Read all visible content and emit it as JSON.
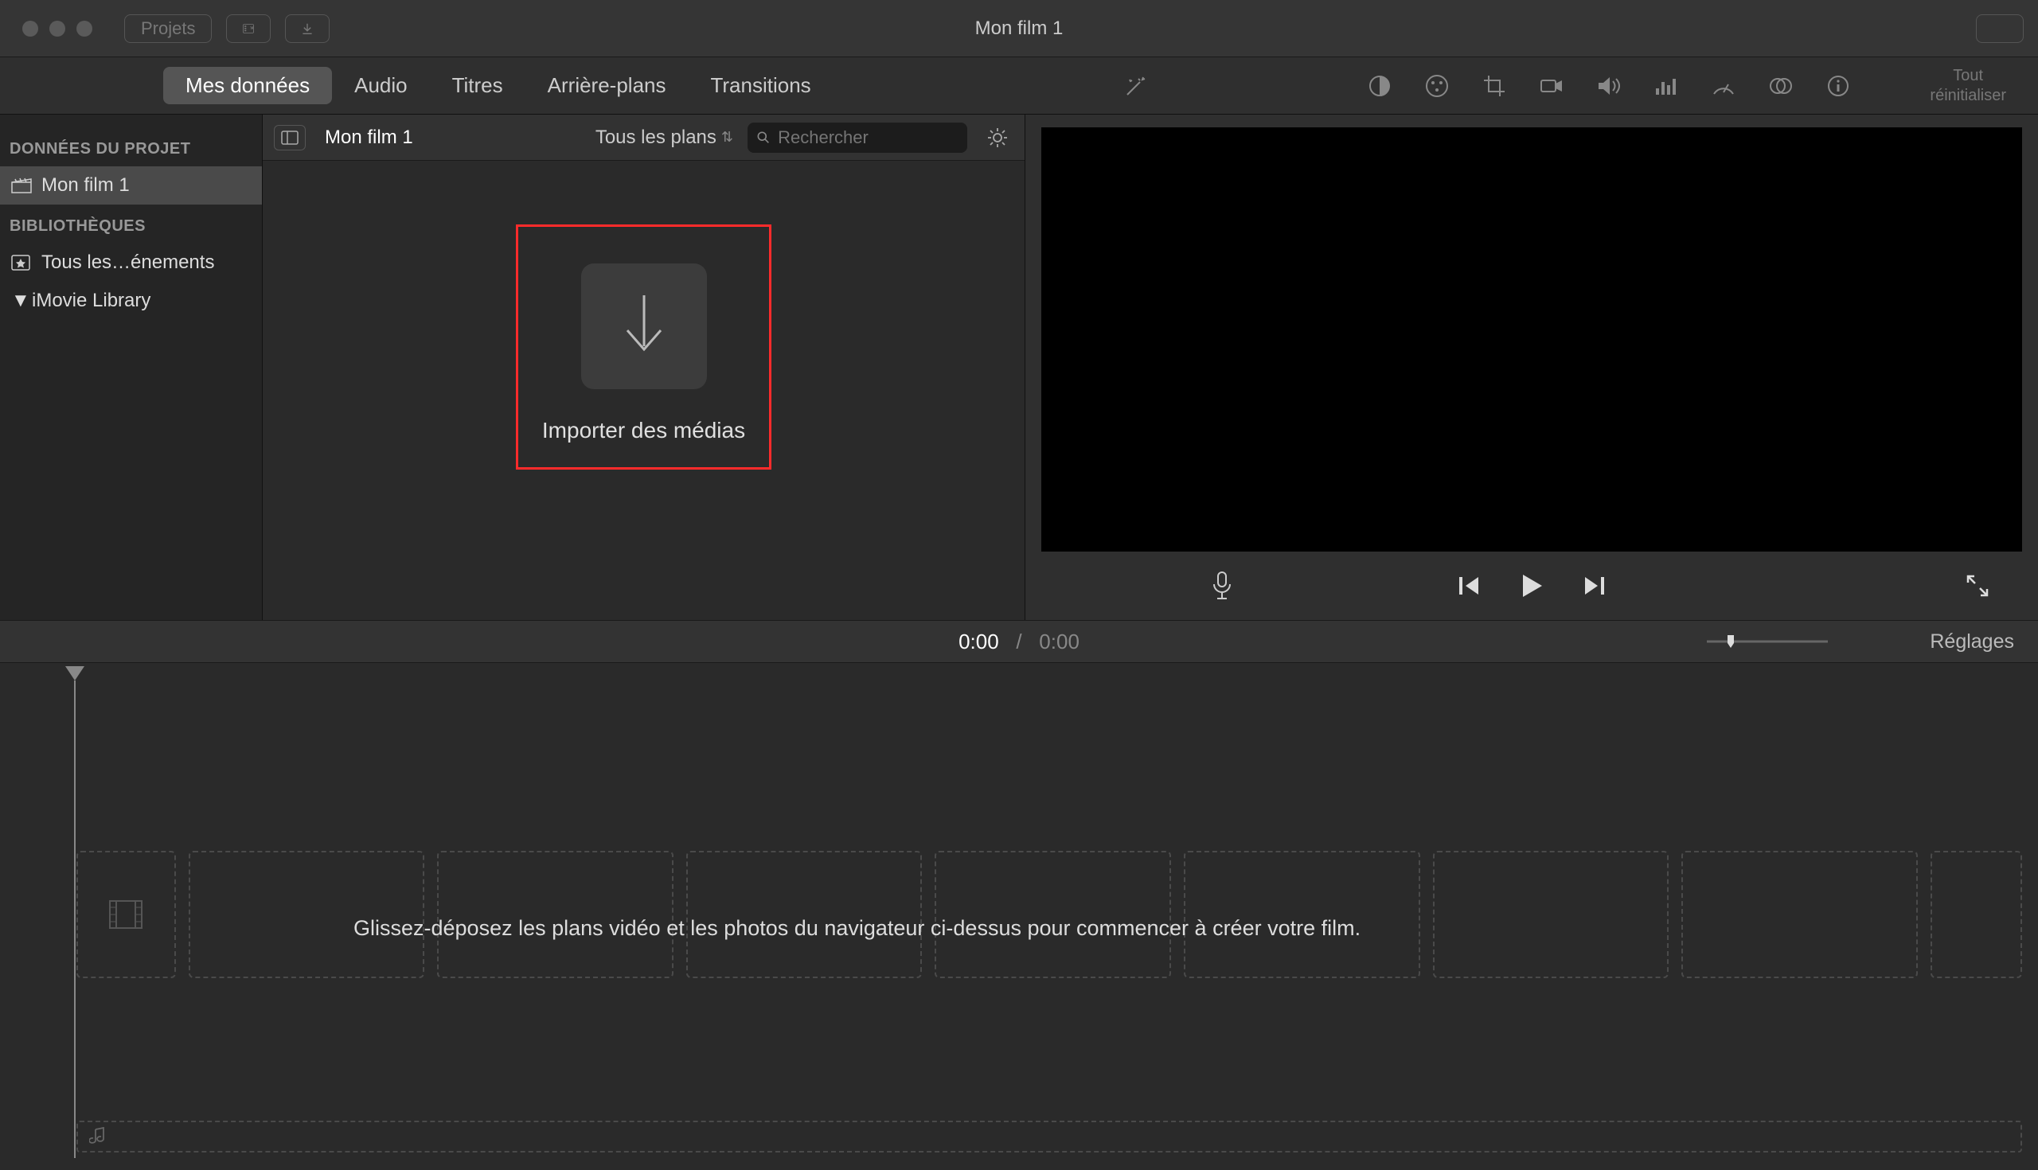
{
  "titlebar": {
    "projects_btn": "Projets",
    "title": "Mon film 1"
  },
  "tabs": {
    "my_media": "Mes données",
    "audio": "Audio",
    "titles": "Titres",
    "backgrounds": "Arrière-plans",
    "transitions": "Transitions"
  },
  "viewer_toolbar": {
    "reset_line1": "Tout",
    "reset_line2": "réinitialiser"
  },
  "sidebar": {
    "section1_header": "DONNÉES DU PROJET",
    "project_item": "Mon film 1",
    "section2_header": "BIBLIOTHÈQUES",
    "all_events": "Tous les…énements",
    "library": "iMovie Library"
  },
  "browser": {
    "title": "Mon film 1",
    "filter": "Tous les plans",
    "search_placeholder": "Rechercher",
    "import_label": "Importer des médias"
  },
  "timeline_hdr": {
    "current": "0:00",
    "sep": "/",
    "total": "0:00",
    "settings": "Réglages"
  },
  "timeline": {
    "hint": "Glissez-déposez les plans vidéo et les photos du navigateur ci-dessus pour commencer à créer votre film."
  }
}
